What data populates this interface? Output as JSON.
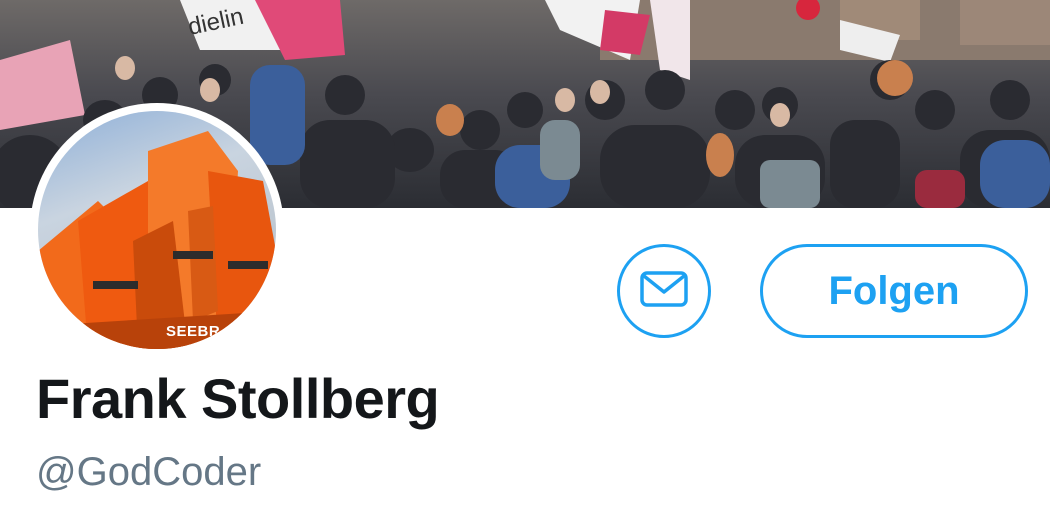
{
  "profile": {
    "display_name": "Frank Stollberg",
    "handle": "@GodCoder",
    "avatar_stamp_text": "SEEBR"
  },
  "actions": {
    "follow_label": "Folgen"
  },
  "banner": {
    "flag_text": "dielin"
  },
  "icons": {
    "message": "envelope-icon"
  },
  "colors": {
    "accent": "#1da1f2",
    "name_text": "#14171a",
    "handle_text": "#657786",
    "background": "#ffffff"
  }
}
